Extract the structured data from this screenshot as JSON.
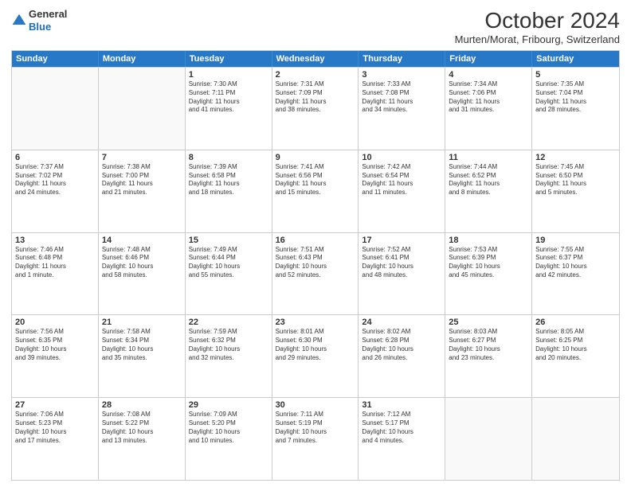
{
  "header": {
    "logo_general": "General",
    "logo_blue": "Blue",
    "month_title": "October 2024",
    "location": "Murten/Morat, Fribourg, Switzerland"
  },
  "weekdays": [
    "Sunday",
    "Monday",
    "Tuesday",
    "Wednesday",
    "Thursday",
    "Friday",
    "Saturday"
  ],
  "weeks": [
    [
      {
        "day": "",
        "empty": true
      },
      {
        "day": "",
        "empty": true
      },
      {
        "day": "1",
        "info": "Sunrise: 7:30 AM\nSunset: 7:11 PM\nDaylight: 11 hours\nand 41 minutes."
      },
      {
        "day": "2",
        "info": "Sunrise: 7:31 AM\nSunset: 7:09 PM\nDaylight: 11 hours\nand 38 minutes."
      },
      {
        "day": "3",
        "info": "Sunrise: 7:33 AM\nSunset: 7:08 PM\nDaylight: 11 hours\nand 34 minutes."
      },
      {
        "day": "4",
        "info": "Sunrise: 7:34 AM\nSunset: 7:06 PM\nDaylight: 11 hours\nand 31 minutes."
      },
      {
        "day": "5",
        "info": "Sunrise: 7:35 AM\nSunset: 7:04 PM\nDaylight: 11 hours\nand 28 minutes."
      }
    ],
    [
      {
        "day": "6",
        "info": "Sunrise: 7:37 AM\nSunset: 7:02 PM\nDaylight: 11 hours\nand 24 minutes."
      },
      {
        "day": "7",
        "info": "Sunrise: 7:38 AM\nSunset: 7:00 PM\nDaylight: 11 hours\nand 21 minutes."
      },
      {
        "day": "8",
        "info": "Sunrise: 7:39 AM\nSunset: 6:58 PM\nDaylight: 11 hours\nand 18 minutes."
      },
      {
        "day": "9",
        "info": "Sunrise: 7:41 AM\nSunset: 6:56 PM\nDaylight: 11 hours\nand 15 minutes."
      },
      {
        "day": "10",
        "info": "Sunrise: 7:42 AM\nSunset: 6:54 PM\nDaylight: 11 hours\nand 11 minutes."
      },
      {
        "day": "11",
        "info": "Sunrise: 7:44 AM\nSunset: 6:52 PM\nDaylight: 11 hours\nand 8 minutes."
      },
      {
        "day": "12",
        "info": "Sunrise: 7:45 AM\nSunset: 6:50 PM\nDaylight: 11 hours\nand 5 minutes."
      }
    ],
    [
      {
        "day": "13",
        "info": "Sunrise: 7:46 AM\nSunset: 6:48 PM\nDaylight: 11 hours\nand 1 minute."
      },
      {
        "day": "14",
        "info": "Sunrise: 7:48 AM\nSunset: 6:46 PM\nDaylight: 10 hours\nand 58 minutes."
      },
      {
        "day": "15",
        "info": "Sunrise: 7:49 AM\nSunset: 6:44 PM\nDaylight: 10 hours\nand 55 minutes."
      },
      {
        "day": "16",
        "info": "Sunrise: 7:51 AM\nSunset: 6:43 PM\nDaylight: 10 hours\nand 52 minutes."
      },
      {
        "day": "17",
        "info": "Sunrise: 7:52 AM\nSunset: 6:41 PM\nDaylight: 10 hours\nand 48 minutes."
      },
      {
        "day": "18",
        "info": "Sunrise: 7:53 AM\nSunset: 6:39 PM\nDaylight: 10 hours\nand 45 minutes."
      },
      {
        "day": "19",
        "info": "Sunrise: 7:55 AM\nSunset: 6:37 PM\nDaylight: 10 hours\nand 42 minutes."
      }
    ],
    [
      {
        "day": "20",
        "info": "Sunrise: 7:56 AM\nSunset: 6:35 PM\nDaylight: 10 hours\nand 39 minutes."
      },
      {
        "day": "21",
        "info": "Sunrise: 7:58 AM\nSunset: 6:34 PM\nDaylight: 10 hours\nand 35 minutes."
      },
      {
        "day": "22",
        "info": "Sunrise: 7:59 AM\nSunset: 6:32 PM\nDaylight: 10 hours\nand 32 minutes."
      },
      {
        "day": "23",
        "info": "Sunrise: 8:01 AM\nSunset: 6:30 PM\nDaylight: 10 hours\nand 29 minutes."
      },
      {
        "day": "24",
        "info": "Sunrise: 8:02 AM\nSunset: 6:28 PM\nDaylight: 10 hours\nand 26 minutes."
      },
      {
        "day": "25",
        "info": "Sunrise: 8:03 AM\nSunset: 6:27 PM\nDaylight: 10 hours\nand 23 minutes."
      },
      {
        "day": "26",
        "info": "Sunrise: 8:05 AM\nSunset: 6:25 PM\nDaylight: 10 hours\nand 20 minutes."
      }
    ],
    [
      {
        "day": "27",
        "info": "Sunrise: 7:06 AM\nSunset: 5:23 PM\nDaylight: 10 hours\nand 17 minutes."
      },
      {
        "day": "28",
        "info": "Sunrise: 7:08 AM\nSunset: 5:22 PM\nDaylight: 10 hours\nand 13 minutes."
      },
      {
        "day": "29",
        "info": "Sunrise: 7:09 AM\nSunset: 5:20 PM\nDaylight: 10 hours\nand 10 minutes."
      },
      {
        "day": "30",
        "info": "Sunrise: 7:11 AM\nSunset: 5:19 PM\nDaylight: 10 hours\nand 7 minutes."
      },
      {
        "day": "31",
        "info": "Sunrise: 7:12 AM\nSunset: 5:17 PM\nDaylight: 10 hours\nand 4 minutes."
      },
      {
        "day": "",
        "empty": true
      },
      {
        "day": "",
        "empty": true
      }
    ]
  ]
}
